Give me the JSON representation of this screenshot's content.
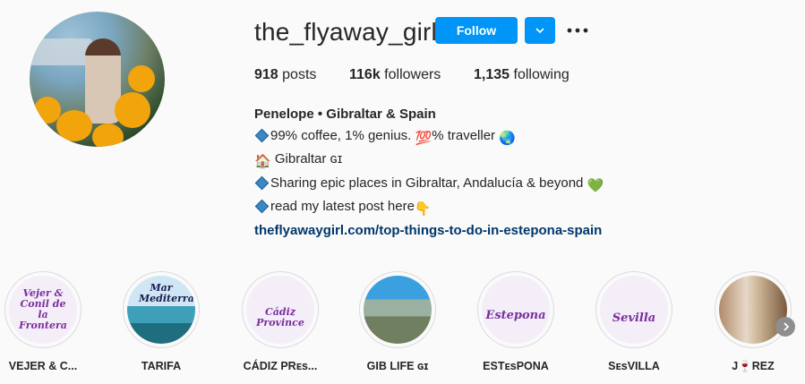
{
  "profile": {
    "username": "the_flyaway_girl",
    "follow_label": "Follow",
    "avatar_icon": "profile-photo",
    "accent": "#0095f6"
  },
  "stats": {
    "posts_count": "918",
    "posts_label": " posts",
    "followers_count": "116k",
    "followers_label": " followers",
    "following_count": "1,135",
    "following_label": " following"
  },
  "bio": {
    "name": "Penelope • Gibraltar & Spain",
    "line1": "99% coffee, 1% genius. ",
    "line1_emoji": "💯",
    "line1_rest": "% traveller ",
    "line1_end_emoji": "🌏",
    "line2_emoji": "🏠",
    "line2": " Gibraltar ɢɪ",
    "line3": "Sharing epic places in Gibraltar, Andalucía & beyond ",
    "line3_emoji": "💚",
    "line4": "read my latest post here",
    "line4_emoji": "👇",
    "link": "theflyawaygirl.com/top-things-to-do-in-estepona-spain"
  },
  "highlights": [
    {
      "title": "VEJER & C...",
      "cover_text": "Vejer & Conil de la Frontera"
    },
    {
      "title": "TARIFA",
      "cover_text": "Mar Mediterraneo"
    },
    {
      "title": "CÁDIZ PRᴇs...",
      "cover_text": "Cádiz Province"
    },
    {
      "title": "GIB LIFE ɢɪ",
      "cover_text": ""
    },
    {
      "title": "ESTᴇsPONA",
      "cover_text": "Estepona"
    },
    {
      "title": "SᴇsVILLA",
      "cover_text": "Sevilla"
    },
    {
      "title": "J🍷REZ",
      "cover_text": ""
    }
  ]
}
